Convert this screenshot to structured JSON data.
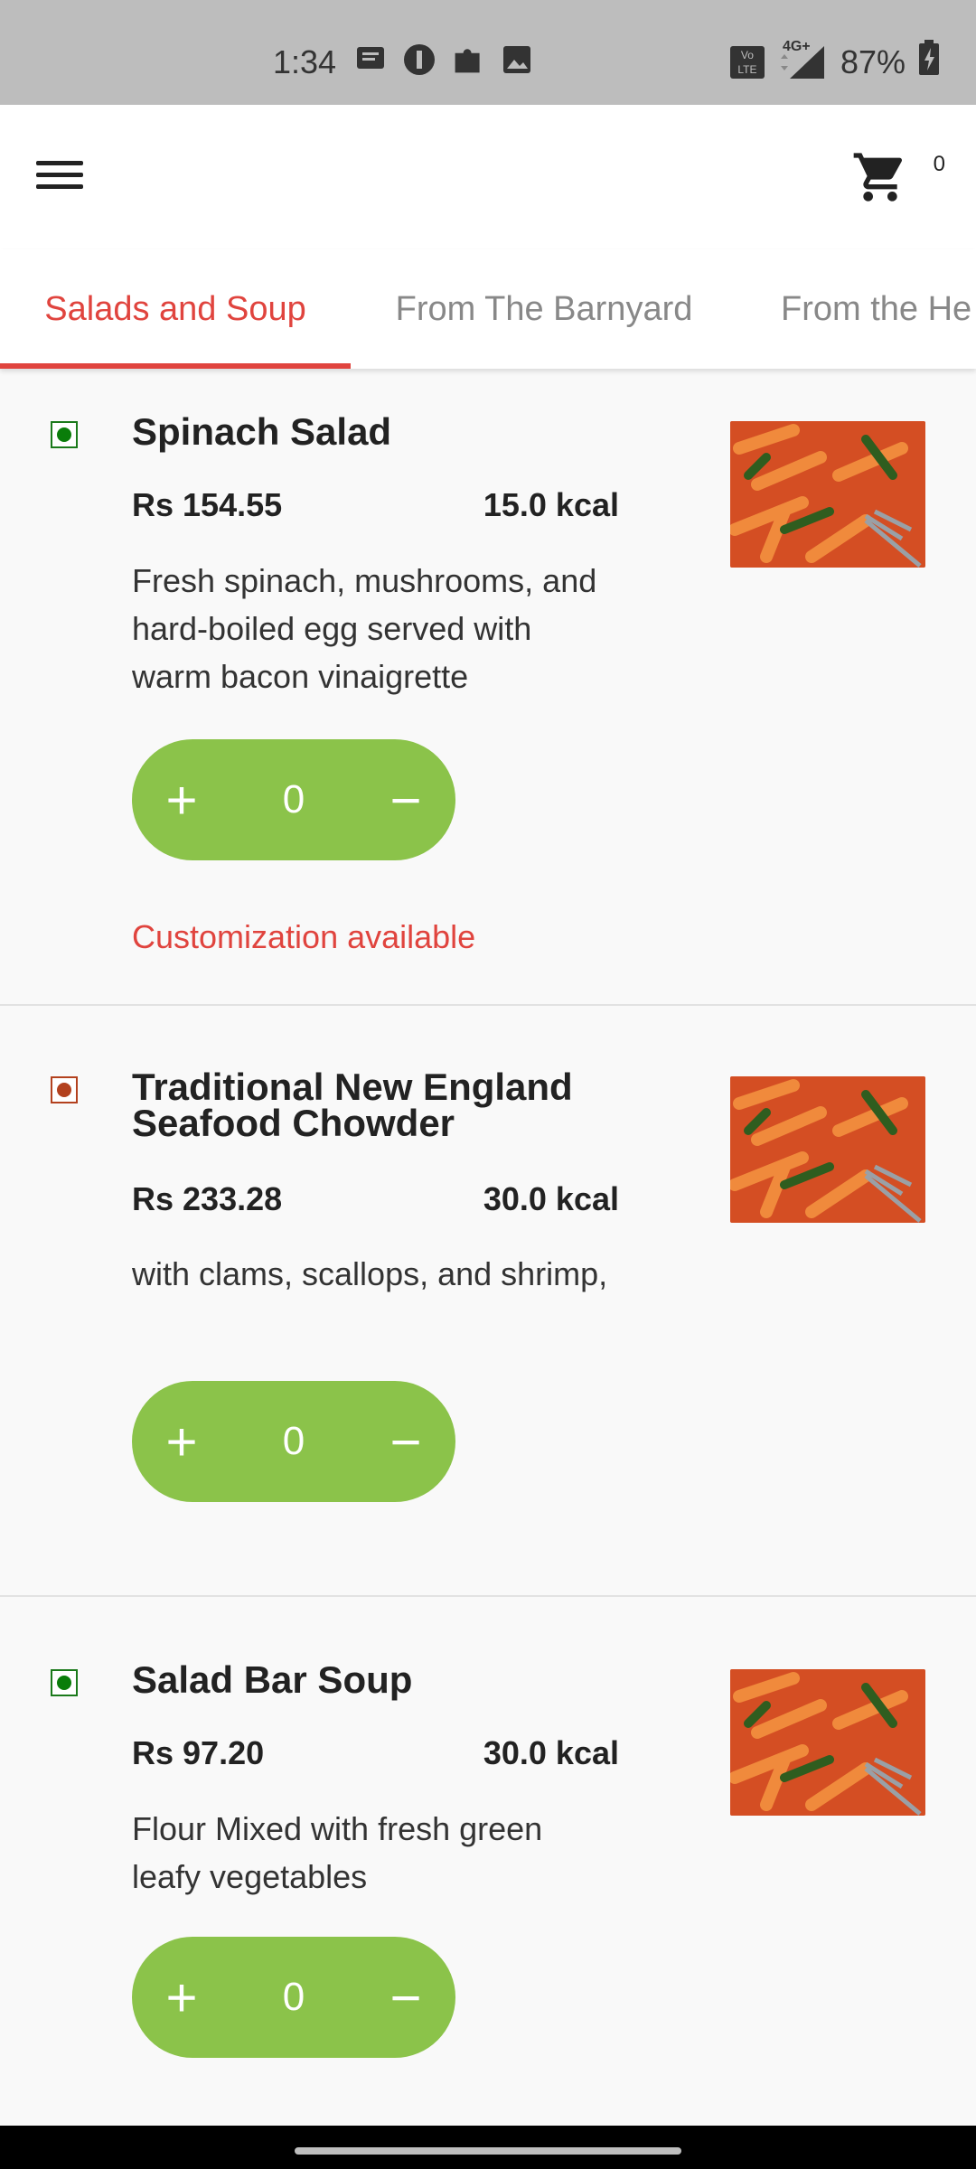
{
  "status_bar": {
    "time": "1:34",
    "icons": [
      "message-icon",
      "half-circle-app-icon",
      "puzzle-icon",
      "image-icon"
    ],
    "network": "4G+",
    "volte": "Vo LTE",
    "battery": "87%"
  },
  "app_bar": {
    "cart_count": "0"
  },
  "tabs": [
    {
      "label": "Salads and Soup",
      "active": true
    },
    {
      "label": "From The Barnyard",
      "active": false
    },
    {
      "label": "From the He",
      "active": false
    }
  ],
  "items": [
    {
      "veg": true,
      "name": "Spinach Salad",
      "price": "Rs 154.55",
      "kcal": "15.0 kcal",
      "description": "Fresh spinach, mushrooms, and hard-boiled egg served with warm bacon vinaigrette",
      "quantity": "0",
      "customization": "Customization available"
    },
    {
      "veg": false,
      "name": "Traditional New England Seafood Chowder",
      "price": "Rs 233.28",
      "kcal": "30.0 kcal",
      "description": "with clams, scallops, and shrimp,",
      "quantity": "0"
    },
    {
      "veg": true,
      "name": "Salad Bar Soup",
      "price": "Rs 97.20",
      "kcal": "30.0 kcal",
      "description": "Flour Mixed with fresh green leafy vegetables",
      "quantity": "0"
    }
  ],
  "colors": {
    "accent": "#e0443e",
    "stepper": "#8bc34a",
    "veg": "#0a7d0a",
    "nonveg": "#b3411e"
  }
}
